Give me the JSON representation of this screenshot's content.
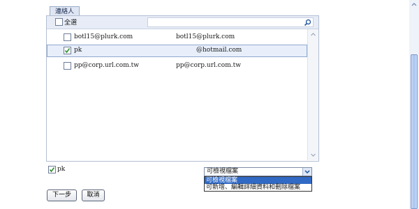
{
  "tab": {
    "label": "連絡人"
  },
  "list_header": {
    "select_all_label": "全選",
    "search_placeholder": ""
  },
  "contacts": [
    {
      "name": "botl15@plurk.com",
      "email": "botl15@plurk.com",
      "checked": false
    },
    {
      "name": "pk",
      "email": "@hotmail.com",
      "checked": true
    },
    {
      "name": "pp@corp.url.com.tw",
      "email": "pp@corp.url.com.tw",
      "checked": false
    }
  ],
  "selected": {
    "label": "pk",
    "checked": true
  },
  "permission": {
    "value": "可檢視檔案",
    "options": [
      "可檢視檔案",
      "可新增、編輯詳細資料和刪除檔案"
    ],
    "highlighted_index": 0
  },
  "buttons": {
    "next": "下一步",
    "cancel": "取消"
  },
  "colors": {
    "check_mark": "#2f8f2f",
    "selection_border": "#8ea6cf",
    "option_highlight": "#316ac5"
  }
}
